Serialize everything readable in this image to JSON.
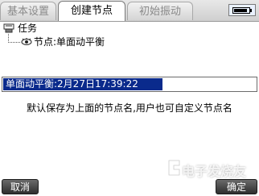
{
  "tabs": [
    {
      "label": "基本设置"
    },
    {
      "label": "创建节点"
    },
    {
      "label": "初始振动"
    }
  ],
  "tree": {
    "root_label": "任务",
    "child_label": "节点:单面动平衡"
  },
  "name_field": {
    "value": "单面动平衡:2月27日17:39:22"
  },
  "hint_text": "默认保存为上面的节点名,用户也可自定义节点名",
  "buttons": {
    "cancel_label": "取消",
    "ok_label": "确定"
  },
  "watermark": {
    "text": "电子发烧友",
    "logo_icon": "watermark-logo-icon"
  },
  "status": {
    "battery_level": 0.9
  },
  "colors": {
    "selection": "#0a2a8c",
    "button": "#3c3c3c",
    "active_tab": "#ffffff"
  }
}
